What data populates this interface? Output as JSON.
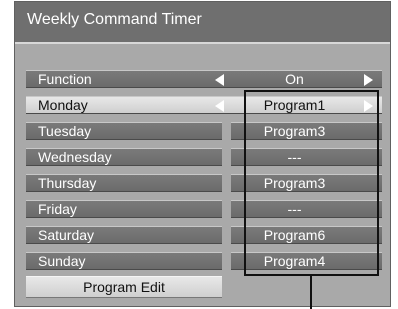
{
  "title": "Weekly Command Timer",
  "rows": [
    {
      "label": "Function",
      "value": "On",
      "active": false
    },
    {
      "label": "Monday",
      "value": "Program1",
      "active": true
    },
    {
      "label": "Tuesday",
      "value": "Program3",
      "active": false
    },
    {
      "label": "Wednesday",
      "value": "---",
      "active": false
    },
    {
      "label": "Thursday",
      "value": "Program3",
      "active": false
    },
    {
      "label": "Friday",
      "value": "---",
      "active": false
    },
    {
      "label": "Saturday",
      "value": "Program6",
      "active": false
    },
    {
      "label": "Sunday",
      "value": "Program4",
      "active": false
    }
  ],
  "program_edit_label": "Program Edit"
}
